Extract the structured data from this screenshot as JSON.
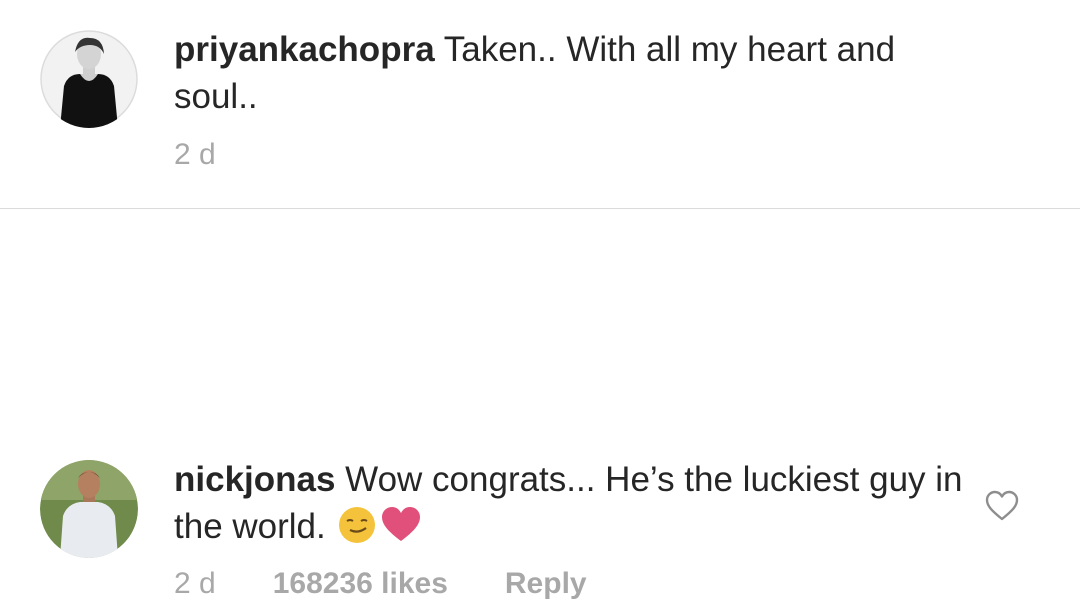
{
  "comments": [
    {
      "username": "priyankachopra",
      "text": " Taken.. With all my heart and soul..",
      "time": "2 d",
      "avatar_icon": "avatar-woman-black-top-icon"
    },
    {
      "username": "nickjonas",
      "text": " Wow congrats... He’s the luckiest guy in the world. ",
      "emojis": [
        "smirk-face-emoji",
        "pink-heart-emoji"
      ],
      "time": "2 d",
      "likes": "168236 likes",
      "reply_label": "Reply",
      "like_icon": "heart-outline-icon",
      "avatar_icon": "avatar-man-white-tee-icon"
    }
  ],
  "colors": {
    "text": "#262626",
    "meta": "#a8a8a8",
    "divider": "#dbdbdb",
    "heart_emoji": "#e0507a",
    "face_emoji": "#f5c33b"
  }
}
